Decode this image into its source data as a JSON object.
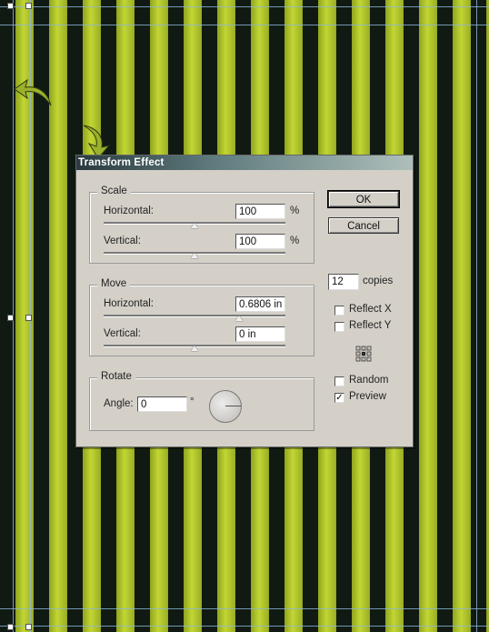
{
  "dialog": {
    "title": "Transform Effect",
    "scale": {
      "legend": "Scale",
      "horizontal_label": "Horizontal:",
      "horizontal_value": "100",
      "horizontal_unit": "%",
      "vertical_label": "Vertical:",
      "vertical_value": "100",
      "vertical_unit": "%"
    },
    "move": {
      "legend": "Move",
      "horizontal_label": "Horizontal:",
      "horizontal_value": "0.6806 in",
      "vertical_label": "Vertical:",
      "vertical_value": "0 in"
    },
    "rotate": {
      "legend": "Rotate",
      "angle_label": "Angle:",
      "angle_value": "0",
      "angle_unit": "°"
    },
    "buttons": {
      "ok": "OK",
      "cancel": "Cancel"
    },
    "copies": {
      "value": "12",
      "label": "copies"
    },
    "options": {
      "reflect_x": {
        "label": "Reflect X",
        "checked": false
      },
      "reflect_y": {
        "label": "Reflect Y",
        "checked": false
      },
      "random": {
        "label": "Random",
        "checked": false
      },
      "preview": {
        "label": "Preview",
        "checked": true
      }
    },
    "check_mark": "✓"
  },
  "colors": {
    "stripe_dark": "#101a12",
    "stripe_lime": "#c2d634",
    "dialog_bg": "#d4d0c8",
    "guide": "#8fb6d8"
  },
  "icons": {
    "rotate_arrow_left": "curved-arrow-icon",
    "rotate_arrow_down": "curved-arrow-icon",
    "reference_point": "reference-point-icon",
    "angle_dial": "angle-dial-icon"
  }
}
